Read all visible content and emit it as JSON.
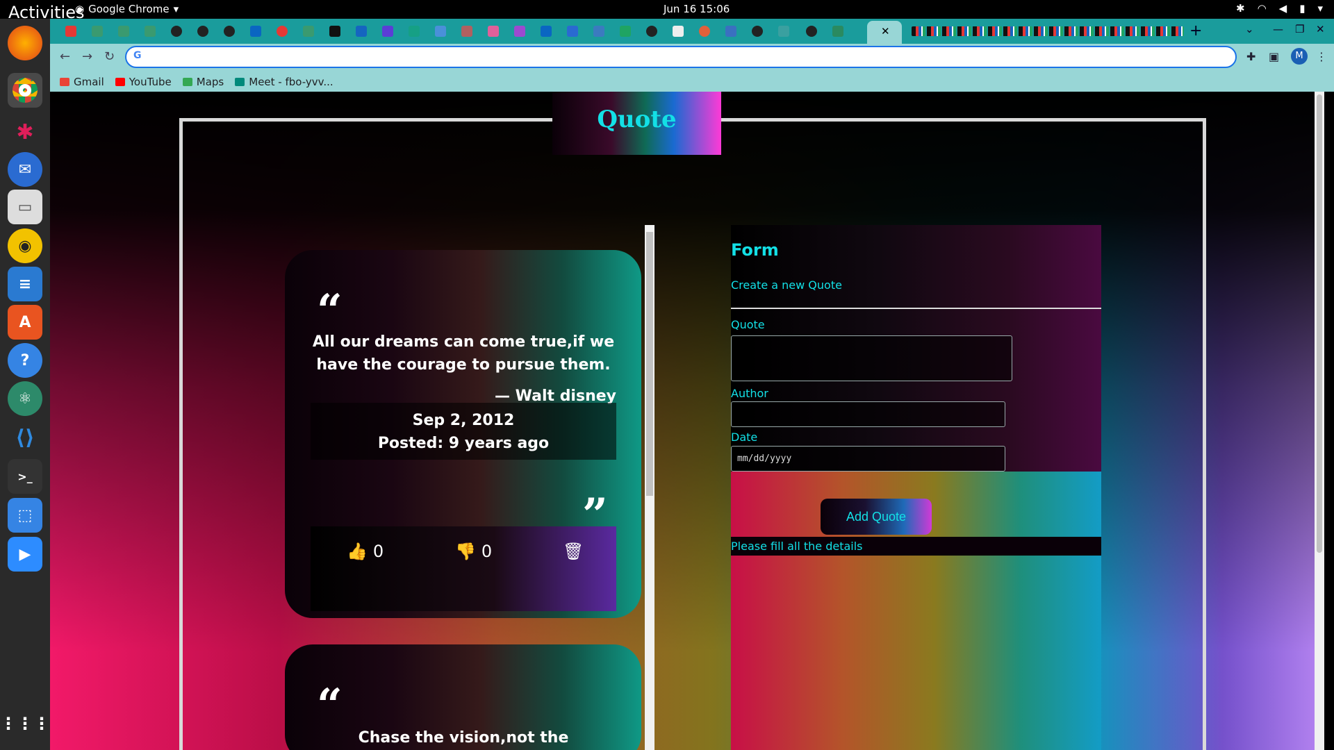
{
  "system": {
    "activities": "Activities",
    "app_menu": "Google Chrome",
    "clock": "Jun 16  15:06",
    "tray_icons": [
      "slack-tray-icon",
      "wifi-icon",
      "volume-icon",
      "battery-icon",
      "power-menu-icon"
    ]
  },
  "dock": {
    "items": [
      "firefox",
      "chrome",
      "slack",
      "thunderbird",
      "files",
      "rhythmbox",
      "writer",
      "software",
      "help",
      "atom",
      "vscode",
      "terminal",
      "screenshot",
      "zoom",
      "app-grid"
    ]
  },
  "browser": {
    "active_tab_close": "✕",
    "new_tab": "+",
    "omnibox_value": "",
    "avatar_letter": "M",
    "bookmarks": [
      "Gmail",
      "YouTube",
      "Maps",
      "Meet - fbo-yvv..."
    ],
    "accent": "#1a9c9c"
  },
  "page": {
    "title": "Quote",
    "cards": [
      {
        "quote": "All our dreams can come true,if we have the courage to pursue them.",
        "author": "— Walt disney",
        "date": "Sep 2, 2012",
        "posted": "Posted: 9 years ago",
        "likes": "0",
        "dislikes": "0"
      },
      {
        "quote": "Chase the vision,not the money,the"
      }
    ],
    "form": {
      "heading": "Form",
      "subheading": "Create a new Quote",
      "quote_label": "Quote",
      "author_label": "Author",
      "date_label": "Date",
      "date_placeholder": "mm/dd/yyyy",
      "submit_label": "Add Quote",
      "message": "Please fill all the details"
    },
    "accent_color": "#13e0e6"
  }
}
